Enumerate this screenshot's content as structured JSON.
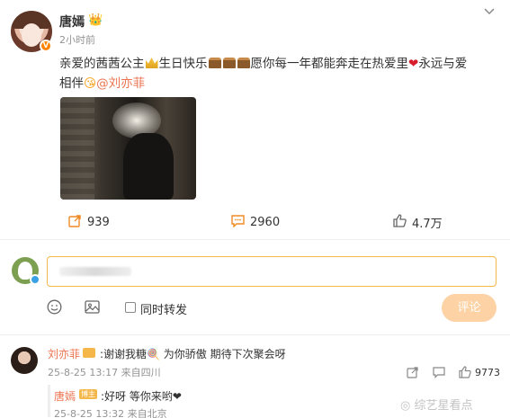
{
  "post": {
    "username": "唐嫣",
    "time": "2小时前",
    "text_part1": "亲爱的茜茜公主",
    "text_part2": "生日快乐",
    "text_part3": "愿你每一年都能奔走在热爱里",
    "text_part4": "永远与爱相伴",
    "mention": "@刘亦菲",
    "heart": "❤",
    "smile": "😘"
  },
  "actions": {
    "repost_count": "939",
    "comment_count": "2960",
    "like_count": "4.7万"
  },
  "composer": {
    "placeholder": "",
    "repost_label": "同时转发",
    "submit_label": "评论"
  },
  "comments": [
    {
      "user": "刘亦菲",
      "text": ":谢谢我糖🍭 为你骄傲 期待下次聚会呀",
      "meta": "25-8-25 13:17 来自四川",
      "likes": "9773"
    }
  ],
  "reply": {
    "user": "唐嫣",
    "badge": "博主",
    "text": ":好呀 等你来哟❤",
    "meta": "25-8-25 13:32 来自北京"
  },
  "watermark": "综艺星看点",
  "colors": {
    "accent": "#eb7350",
    "orange": "#ff8200",
    "input_border": "#f2b84b",
    "button_bg": "#fdd2a4"
  },
  "icons": [
    "crown-icon",
    "chevron-down-icon",
    "repost-icon",
    "comment-icon",
    "like-icon",
    "emoji-icon",
    "image-icon",
    "share-icon",
    "comment-reply-icon",
    "weibo-icon"
  ]
}
